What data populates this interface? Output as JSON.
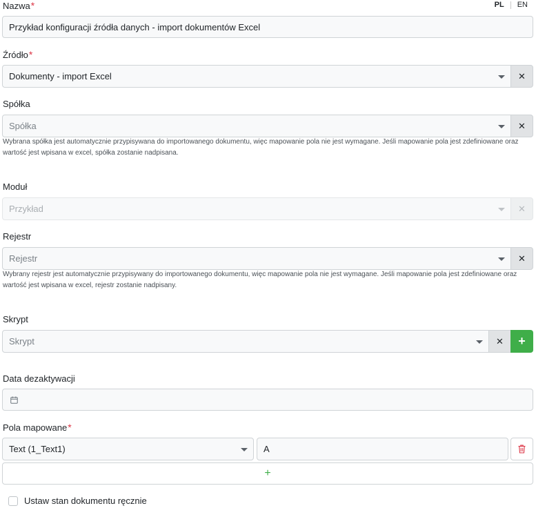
{
  "language": {
    "pl": "PL",
    "en": "EN"
  },
  "required_mark": "*",
  "name": {
    "label": "Nazwa",
    "value": "Przykład konfiguracji źródła danych - import dokumentów Excel"
  },
  "source": {
    "label": "Źródło",
    "value": "Dokumenty - import Excel",
    "clear": "✕"
  },
  "company": {
    "label": "Spółka",
    "placeholder": "Spółka",
    "clear": "✕",
    "help_line1": "Wybrana spółka jest automatycznie przypisywana do importowanego dokumentu, więc mapowanie pola nie jest wymagane. Jeśli mapowanie pola jest zdefiniowane oraz",
    "help_line2": "wartość jest wpisana w excel, spółka zostanie nadpisana."
  },
  "module": {
    "label": "Moduł",
    "placeholder": "Przykład",
    "clear": "✕"
  },
  "register": {
    "label": "Rejestr",
    "placeholder": "Rejestr",
    "clear": "✕",
    "help_line1": "Wybrany rejestr jest automatycznie przypisywany do importowanego dokumentu, więc mapowanie pola nie jest wymagane. Jeśli mapowanie pola jest zdefiniowane oraz",
    "help_line2": "wartość jest wpisana w excel, rejestr zostanie nadpisany."
  },
  "script": {
    "label": "Skrypt",
    "placeholder": "Skrypt",
    "clear": "✕",
    "add": "+"
  },
  "deactivation": {
    "label": "Data dezaktywacji",
    "icon": "calendar-icon"
  },
  "mapped_fields": {
    "label": "Pola mapowane",
    "rows": [
      {
        "field": "Text (1_Text1)",
        "column": "A",
        "delete_icon": "trash-icon"
      }
    ],
    "add": "+"
  },
  "manual_state": {
    "label": "Ustaw stan dokumentu ręcznie",
    "checked": false
  },
  "colors": {
    "required": "#dc3545",
    "success": "#3fae49",
    "danger": "#dc3545"
  }
}
